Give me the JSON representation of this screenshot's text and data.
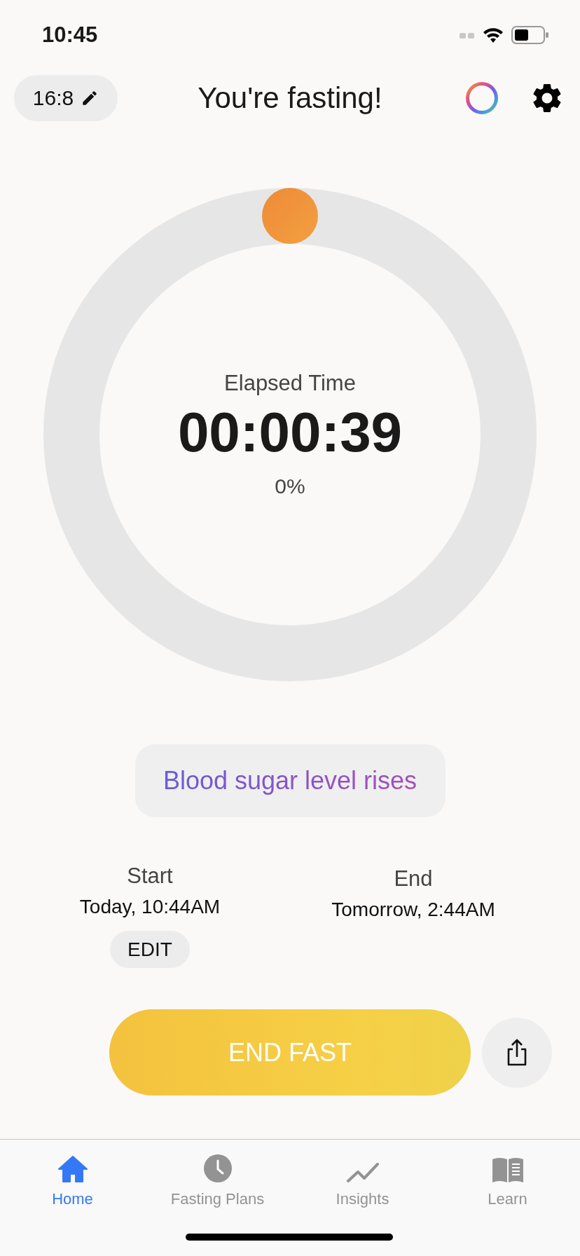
{
  "status_bar": {
    "time": "10:45"
  },
  "header": {
    "plan": "16:8",
    "title": "You're fasting!"
  },
  "timer": {
    "label": "Elapsed Time",
    "elapsed": "00:00:39",
    "percent": "0%"
  },
  "stage": {
    "text": "Blood sugar level rises"
  },
  "schedule": {
    "start": {
      "label": "Start",
      "value": "Today, 10:44AM",
      "action": "EDIT"
    },
    "end": {
      "label": "End",
      "value": "Tomorrow, 2:44AM"
    }
  },
  "primary_action": "END FAST",
  "tabs": [
    {
      "label": "Home",
      "selected": true
    },
    {
      "label": "Fasting Plans",
      "selected": false
    },
    {
      "label": "Insights",
      "selected": false
    },
    {
      "label": "Learn",
      "selected": false
    }
  ]
}
